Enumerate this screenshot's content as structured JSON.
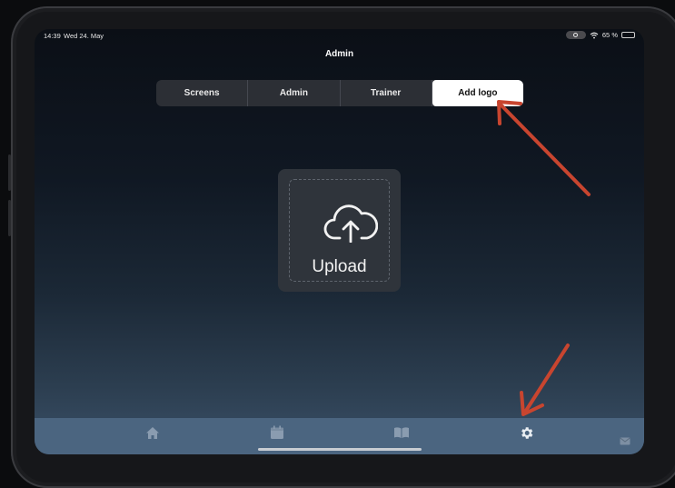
{
  "status_bar": {
    "time": "14:39",
    "date": "Wed 24. May",
    "battery": "65 %",
    "battery_level": 0.65,
    "icons": [
      "focus-icon",
      "wifi-icon",
      "battery-icon"
    ]
  },
  "header": {
    "title": "Admin"
  },
  "tabs": [
    {
      "label": "Screens",
      "active": false
    },
    {
      "label": "Admin",
      "active": false
    },
    {
      "label": "Trainer",
      "active": false
    },
    {
      "label": "Add logo",
      "active": true
    }
  ],
  "upload": {
    "label": "Upload",
    "icon": "cloud-upload-icon"
  },
  "tab_bar": {
    "items": [
      {
        "name": "home-icon"
      },
      {
        "name": "calendar-icon"
      },
      {
        "name": "book-icon"
      },
      {
        "name": "gear-icon",
        "active": true
      }
    ]
  },
  "colors": {
    "accent_arrow": "#c8452f",
    "tab_bar": "#4b6580",
    "segment_bg": "#2c2f35",
    "segment_active": "#ffffff"
  }
}
